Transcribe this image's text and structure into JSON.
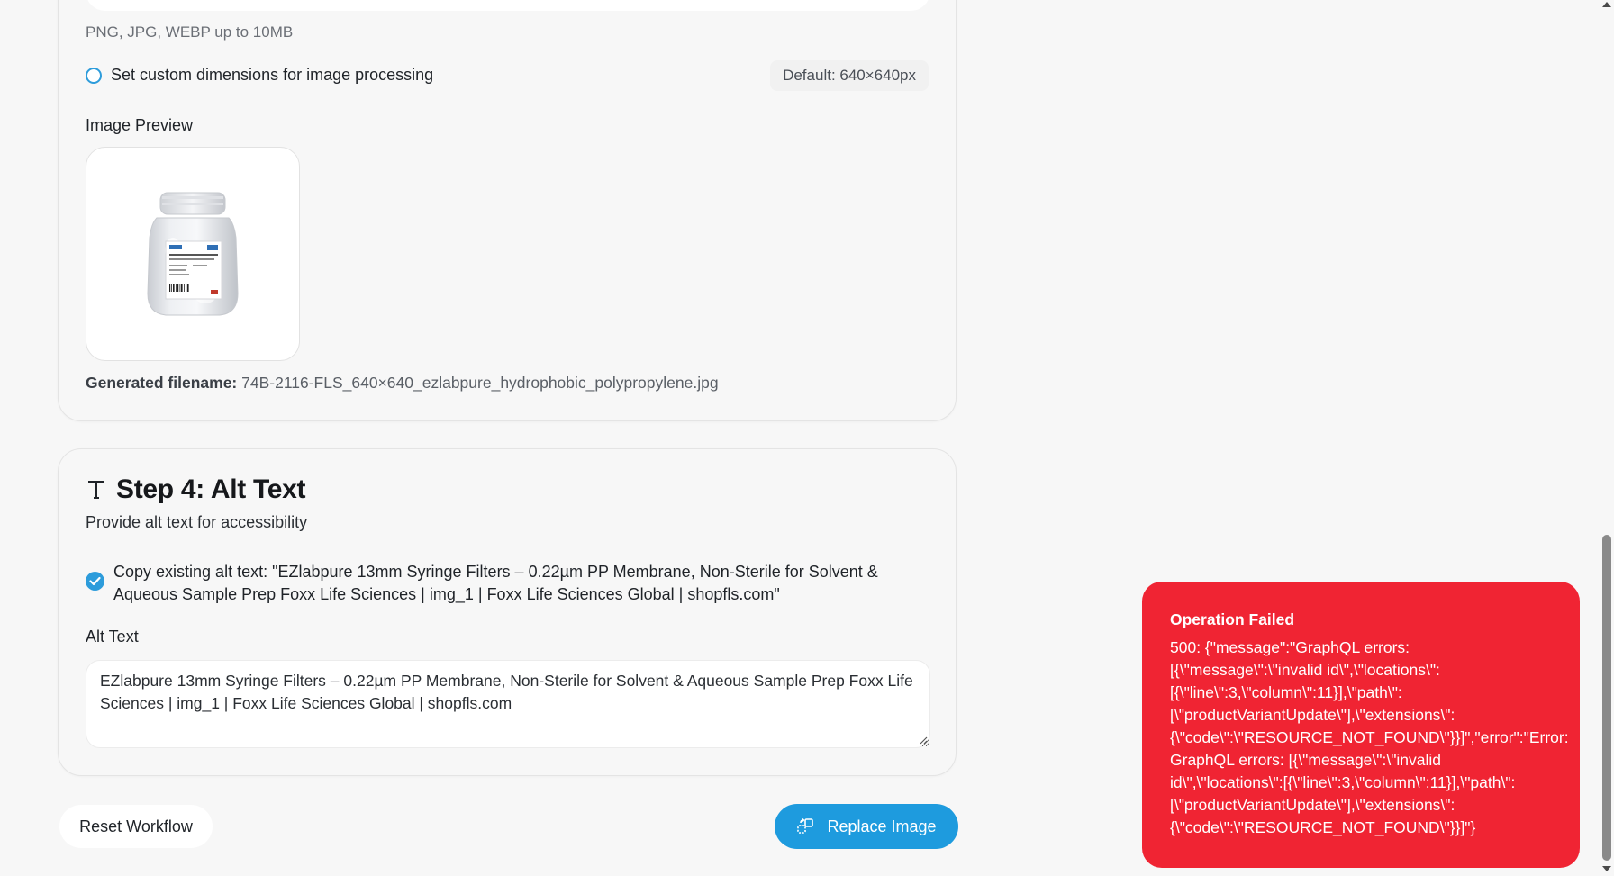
{
  "upload": {
    "hint": "PNG, JPG, WEBP up to 10MB",
    "custom_dimensions_label": "Set custom dimensions for image processing",
    "default_badge": "Default: 640×640px",
    "preview_label": "Image Preview",
    "generated_filename_label": "Generated filename:",
    "generated_filename_value": "74B-2116-FLS_640×640_ezlabpure_hydrophobic_polypropylene.jpg",
    "preview_icon": "product-jar-image"
  },
  "alt_step": {
    "icon": "text-icon",
    "title": "Step 4: Alt Text",
    "subtitle": "Provide alt text for accessibility",
    "copy_checked": true,
    "copy_label": "Copy existing alt text: \"EZlabpure 13mm Syringe Filters – 0.22µm PP Membrane, Non-Sterile for Solvent & Aqueous Sample Prep Foxx Life Sciences | img_1 | Foxx Life Sciences Global | shopfls.com\"",
    "alt_label": "Alt Text",
    "alt_value": "EZlabpure 13mm Syringe Filters – 0.22µm PP Membrane, Non-Sterile for Solvent & Aqueous Sample Prep Foxx Life Sciences | img_1 | Foxx Life Sciences Global | shopfls.com"
  },
  "actions": {
    "reset_label": "Reset Workflow",
    "replace_label": "Replace Image",
    "replace_icon": "replace-image-icon"
  },
  "toast": {
    "title": "Operation Failed",
    "body": "500: {\"message\":\"GraphQL errors:\n[{\\\"message\\\":\\\"invalid id\\\",\\\"locations\\\":\n[{\\\"line\\\":3,\\\"column\\\":11}],\\\"path\\\":\n[\\\"productVariantUpdate\\\"],\\\"extensions\\\":\n{\\\"code\\\":\\\"RESOURCE_NOT_FOUND\\\"}}]\",\"error\":\"Error:\nGraphQL errors: [{\\\"message\\\":\\\"invalid\nid\\\",\\\"locations\\\":[{\\\"line\\\":3,\\\"column\\\":11}],\\\"path\\\":\n[\\\"productVariantUpdate\\\"],\\\"extensions\\\":\n{\\\"code\\\":\\\"RESOURCE_NOT_FOUND\\\"}}]\"}",
    "color": "#f02433"
  },
  "colors": {
    "accent": "#1e9bde",
    "error": "#f02433"
  }
}
